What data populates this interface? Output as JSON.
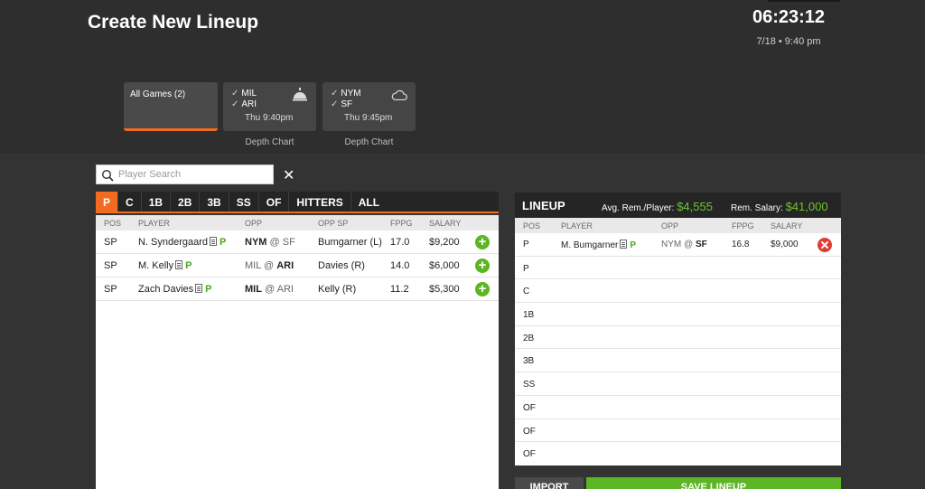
{
  "header": {
    "title": "Create New Lineup",
    "countdown": "06:23:12",
    "date": "7/18 • 9:40 pm"
  },
  "games": {
    "all_label": "All Games (2)",
    "cards": [
      {
        "team1": "MIL",
        "team2": "ARI",
        "time": "Thu 9:40pm",
        "icon": "bell-icon",
        "depth": "Depth Chart"
      },
      {
        "team1": "NYM",
        "team2": "SF",
        "time": "Thu 9:45pm",
        "icon": "cloud-icon",
        "depth": "Depth Chart"
      }
    ]
  },
  "search": {
    "placeholder": "Player Search",
    "clear": "✕"
  },
  "tabs": [
    "P",
    "C",
    "1B",
    "2B",
    "3B",
    "SS",
    "OF",
    "HITTERS",
    "ALL"
  ],
  "pool": {
    "columns": [
      "POS",
      "PLAYER",
      "OPP",
      "OPP SP",
      "FPPG",
      "SALARY"
    ],
    "rows": [
      {
        "pos": "SP",
        "player": "N. Syndergaard",
        "tag": "P",
        "opp_team": "NYM",
        "opp_rest": " @ SF",
        "opp_sp": "Bumgarner (L)",
        "fppg": "17.0",
        "salary": "$9,200"
      },
      {
        "pos": "SP",
        "player": "M. Kelly",
        "tag": "P",
        "opp_team": "MIL @ ",
        "opp_rest": "ARI",
        "opp_sp": "Davies (R)",
        "fppg": "14.0",
        "salary": "$6,000"
      },
      {
        "pos": "SP",
        "player": "Zach Davies",
        "tag": "P",
        "opp_team": "MIL",
        "opp_rest": " @ ARI",
        "opp_sp": "Kelly (R)",
        "fppg": "11.2",
        "salary": "$5,300"
      }
    ]
  },
  "lineup": {
    "title": "LINEUP",
    "avg_label": "Avg. Rem./Player:",
    "avg_value": "$4,555",
    "rem_label": "Rem. Salary:",
    "rem_value": "$41,000",
    "columns": [
      "POS",
      "PLAYER",
      "OPP",
      "FPPG",
      "SALARY"
    ],
    "filled": {
      "pos": "P",
      "player": "M. Bumgarner",
      "tag": "P",
      "opp_team": "NYM @ ",
      "opp_rest": "SF",
      "fppg": "16.8",
      "salary": "$9,000"
    },
    "empty_slots": [
      "P",
      "C",
      "1B",
      "2B",
      "3B",
      "SS",
      "OF",
      "OF",
      "OF"
    ]
  },
  "actions": {
    "import": "IMPORT",
    "save": "SAVE LINEUP"
  },
  "colors": {
    "accent": "#f26b21",
    "green": "#5cb523",
    "remove": "#e03c31"
  }
}
